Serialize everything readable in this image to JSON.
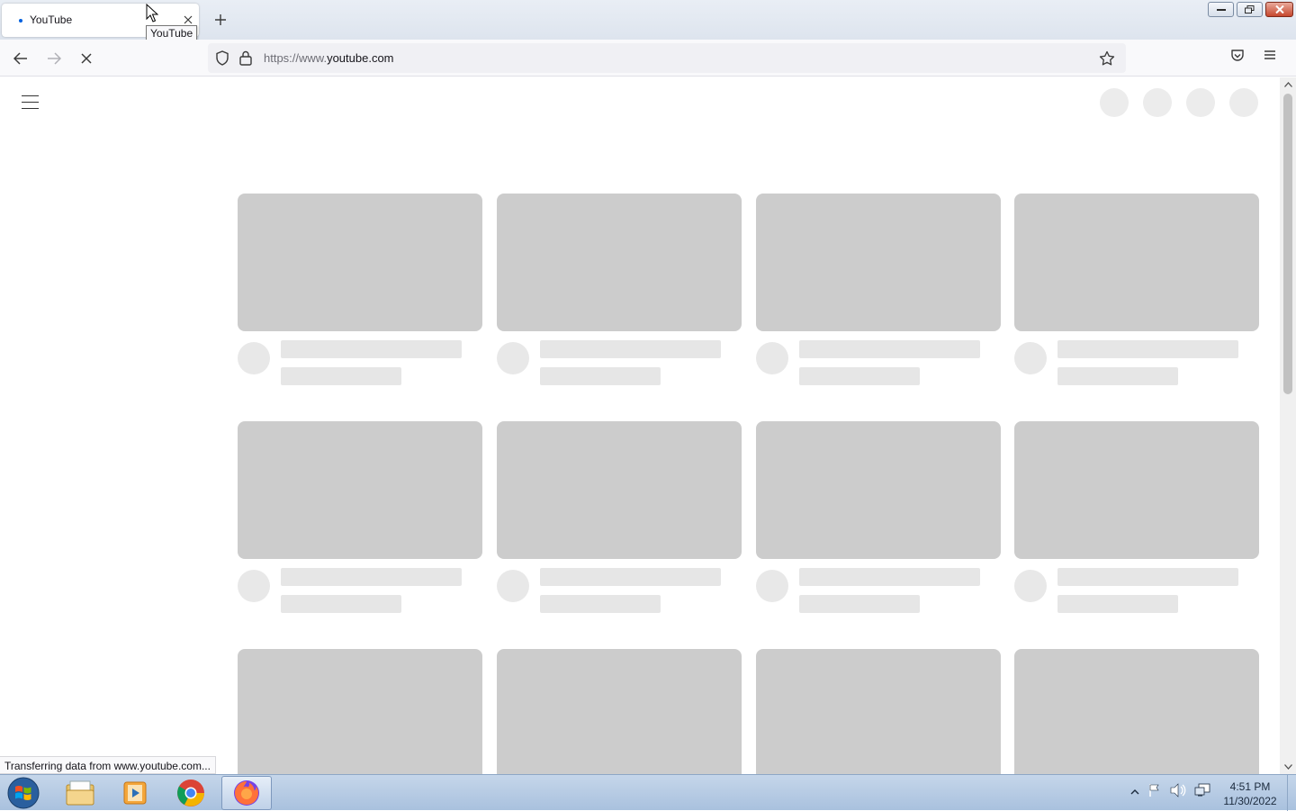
{
  "browser": {
    "tab": {
      "title": "YouTube",
      "tooltip": "YouTube"
    },
    "url": {
      "scheme_prefix": "https://www.",
      "domain": "youtube.com"
    },
    "status_text": "Transferring data from www.youtube.com...",
    "accent_color": "#0060df"
  },
  "page": {
    "site": "YouTube",
    "state": "loading-skeleton",
    "skeleton_color": "#cccccc"
  },
  "taskbar": {
    "apps": [
      {
        "name": "file-explorer-icon"
      },
      {
        "name": "media-player-icon"
      },
      {
        "name": "chrome-icon"
      },
      {
        "name": "firefox-icon",
        "active": true
      }
    ],
    "clock": {
      "time": "4:51 PM",
      "date": "11/30/2022"
    }
  }
}
